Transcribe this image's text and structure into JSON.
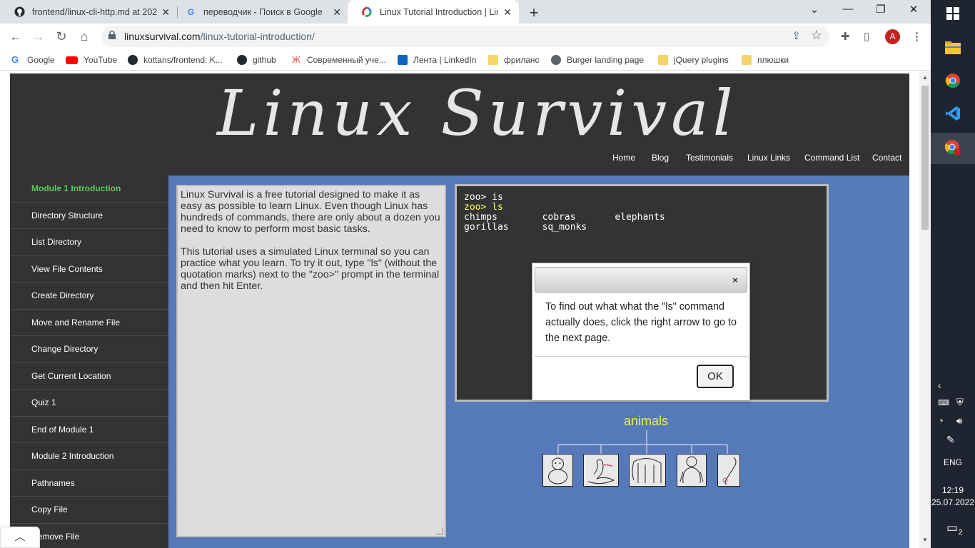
{
  "browser": {
    "tabs": [
      {
        "title": "frontend/linux-cli-http.md at 202",
        "icon": "github-icon"
      },
      {
        "title": "переводчик - Поиск в Google",
        "icon": "google-icon"
      },
      {
        "title": "Linux Tutorial Introduction | Linu",
        "icon": "linuxsurvival-icon"
      }
    ],
    "url_domain": "linuxsurvival.com",
    "url_path": "/linux-tutorial-introduction/",
    "profile_initial": "A",
    "bookmarks": [
      {
        "label": "Google",
        "icon": "google-icon"
      },
      {
        "label": "YouTube",
        "icon": "youtube-icon"
      },
      {
        "label": "kottans/frontend: K...",
        "icon": "github-icon"
      },
      {
        "label": "github",
        "icon": "github-icon"
      },
      {
        "label": "Современный уче...",
        "icon": "javascript-info-icon"
      },
      {
        "label": "Лента | LinkedIn",
        "icon": "linkedin-icon"
      },
      {
        "label": "фриланс",
        "icon": "folder-icon"
      },
      {
        "label": "Burger landing page",
        "icon": "globe-icon"
      },
      {
        "label": "jQuery plugins",
        "icon": "folder-icon"
      },
      {
        "label": "плюшки",
        "icon": "folder-icon"
      }
    ]
  },
  "site": {
    "logo": "Linux Survival",
    "nav": [
      "Home",
      "Blog",
      "Testimonials",
      "Linux Links",
      "Command List",
      "Contact"
    ],
    "sidebar": [
      "Module 1 Introduction",
      "Directory Structure",
      "List Directory",
      "View File Contents",
      "Create Directory",
      "Move and Rename File",
      "Change Directory",
      "Get Current Location",
      "Quiz 1",
      "End of Module 1",
      "Module 2 Introduction",
      "Pathnames",
      "Copy File",
      "Remove File"
    ],
    "content_p1": "Linux Survival is a free tutorial designed to make it as easy as possible to learn Linux. Even though Linux has hundreds of commands, there are only about a dozen you need to know to perform most basic tasks.",
    "content_p2": "This tutorial uses a simulated Linux terminal so you can practice what you learn. To try it out, type \"ls\" (without the quotation marks) next to the \"zoo>\" prompt in the terminal and then hit Enter.",
    "terminal": {
      "line1": "zoo> is",
      "line2": "zoo> ls",
      "output": "chimps        cobras       elephants\ngorillas      sq_monks"
    },
    "tree_title": "animals",
    "animals": [
      "chimp",
      "cobra",
      "elephant",
      "gorilla",
      "squirrel-monkey"
    ]
  },
  "dialog": {
    "message": "To find out what what the \"ls\" command actually does, click the right arrow to go to the next page.",
    "ok_label": "OK",
    "close_label": "×"
  },
  "taskbar": {
    "language": "ENG",
    "time": "12:19",
    "date": "25.07.2022",
    "notifications": "2"
  },
  "colors": {
    "site_background": "#567ab9",
    "header_background": "#333333",
    "active_sidebar": "#5ec75e",
    "terminal_prompt": "#ffff66"
  }
}
